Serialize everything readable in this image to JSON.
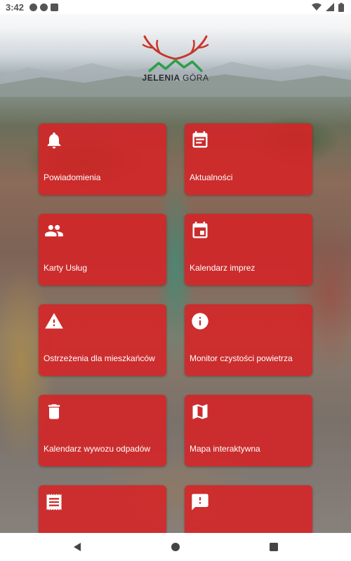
{
  "status_bar": {
    "time": "3:42"
  },
  "logo": {
    "text_bold": "JELENIA",
    "text_light": "GÓRA",
    "colors": {
      "antlers": "#c8352b",
      "mountains": "#2e9e4a"
    }
  },
  "tiles": [
    {
      "label": "Powiadomienia",
      "icon": "bell-icon"
    },
    {
      "label": "Aktualności",
      "icon": "news-icon"
    },
    {
      "label": "Karty Usług",
      "icon": "people-icon"
    },
    {
      "label": "Kalendarz imprez",
      "icon": "calendar-icon"
    },
    {
      "label": "Ostrzeżenia dla mieszkańców",
      "icon": "warning-icon"
    },
    {
      "label": "Monitor czystości powietrza",
      "icon": "info-icon"
    },
    {
      "label": "Kalendarz wywozu odpadów",
      "icon": "trash-icon"
    },
    {
      "label": "Mapa interaktywna",
      "icon": "map-icon"
    },
    {
      "label": "",
      "icon": "receipt-icon"
    },
    {
      "label": "",
      "icon": "feedback-icon"
    }
  ],
  "theme": {
    "tile_color": "#d62326",
    "text_color": "#ffffff"
  }
}
